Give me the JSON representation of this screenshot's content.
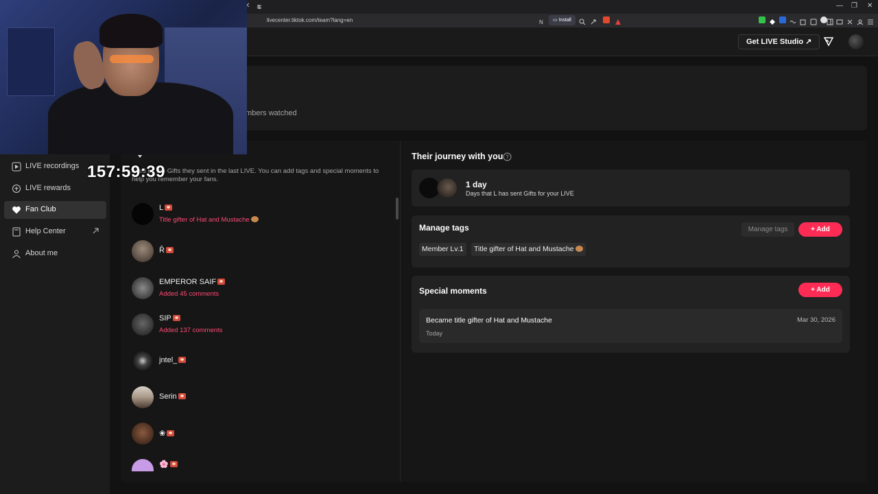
{
  "browser": {
    "url": "livecenter.tiktok.com/team?lang=en",
    "install_label": "Install",
    "new_tab": "+"
  },
  "header": {
    "studio_button": "Get LIVE Studio ↗"
  },
  "summary": {
    "text": "mbers watched"
  },
  "overlay": {
    "timer": "157:59:39"
  },
  "sidebar": {
    "items": [
      {
        "label": "LIVE recordings",
        "icon": "recording-icon"
      },
      {
        "label": "LIVE rewards",
        "icon": "reward-icon"
      },
      {
        "label": "Fan Club",
        "icon": "heart-icon",
        "active": true
      },
      {
        "label": "Help Center",
        "icon": "help-book-icon",
        "external": true
      },
      {
        "label": "About me",
        "icon": "person-icon"
      }
    ]
  },
  "fans": {
    "description": "nked by the Gifts they sent in the last LIVE. You can add tags and special moments to help you remember your fans.",
    "list": [
      {
        "name": "L",
        "sub": "Title gifter of Hat and Mustache"
      },
      {
        "name": "R̂",
        "sub": ""
      },
      {
        "name": "EMPEROR SAIF",
        "sub": "Added 45 comments"
      },
      {
        "name": "SIP",
        "sub": "Added 137 comments"
      },
      {
        "name": "jntel_",
        "sub": ""
      },
      {
        "name": "Serin",
        "sub": ""
      },
      {
        "name": "❀",
        "sub": ""
      },
      {
        "name": "🌸",
        "sub": ""
      }
    ]
  },
  "journey": {
    "title": "Their journey with you",
    "days": "1 day",
    "days_desc": "Days that L has sent Gifts for your LIVE"
  },
  "tags": {
    "title": "Manage tags",
    "manage_button": "Manage tags",
    "add_button": "+ Add",
    "items": [
      "Member Lv.1",
      "Title gifter of Hat and Mustache"
    ]
  },
  "moments": {
    "title": "Special moments",
    "add_button": "+ Add",
    "items": [
      {
        "title": "Became title gifter of Hat and Mustache",
        "sub": "Today",
        "date": "Mar 30, 2026"
      }
    ]
  },
  "colors": {
    "accent": "#fe2c55",
    "background": "#121212",
    "card": "#222222"
  }
}
